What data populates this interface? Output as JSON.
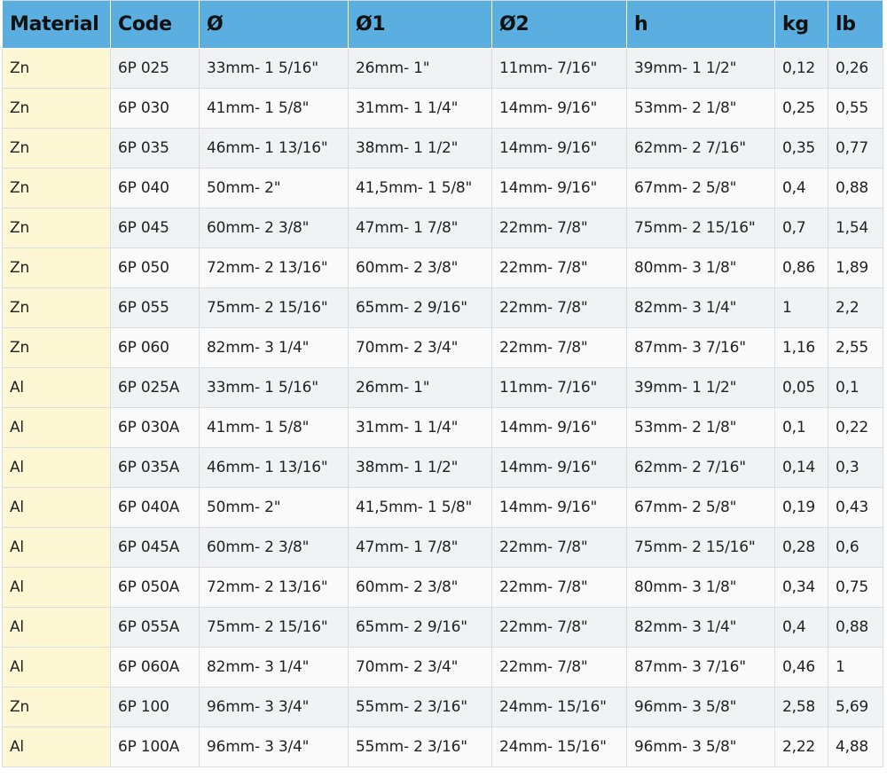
{
  "table": {
    "headers": [
      "Material",
      "Code",
      "Ø",
      "Ø1",
      "Ø2",
      "h",
      "kg",
      "lb"
    ],
    "rows": [
      [
        "Zn",
        "6P 025",
        "33mm- 1 5/16\"",
        "26mm- 1\"",
        "11mm- 7/16\"",
        "39mm- 1 1/2\"",
        "0,12",
        "0,26"
      ],
      [
        "Zn",
        "6P 030",
        "41mm- 1 5/8\"",
        "31mm- 1 1/4\"",
        "14mm- 9/16\"",
        "53mm- 2 1/8\"",
        "0,25",
        "0,55"
      ],
      [
        "Zn",
        "6P 035",
        "46mm- 1 13/16\"",
        "38mm- 1 1/2\"",
        "14mm- 9/16\"",
        "62mm- 2 7/16\"",
        "0,35",
        "0,77"
      ],
      [
        "Zn",
        "6P 040",
        "50mm- 2\"",
        "41,5mm- 1 5/8\"",
        "14mm- 9/16\"",
        "67mm- 2 5/8\"",
        "0,4",
        "0,88"
      ],
      [
        "Zn",
        "6P 045",
        "60mm- 2 3/8\"",
        "47mm- 1 7/8\"",
        "22mm- 7/8\"",
        "75mm- 2 15/16\"",
        "0,7",
        "1,54"
      ],
      [
        "Zn",
        "6P 050",
        "72mm- 2 13/16\"",
        "60mm- 2 3/8\"",
        "22mm- 7/8\"",
        "80mm- 3 1/8\"",
        "0,86",
        "1,89"
      ],
      [
        "Zn",
        "6P 055",
        "75mm- 2 15/16\"",
        "65mm- 2 9/16\"",
        "22mm- 7/8\"",
        "82mm- 3 1/4\"",
        "1",
        "2,2"
      ],
      [
        "Zn",
        "6P 060",
        "82mm- 3 1/4\"",
        "70mm- 2 3/4\"",
        "22mm- 7/8\"",
        "87mm- 3 7/16\"",
        "1,16",
        "2,55"
      ],
      [
        "Al",
        "6P 025A",
        "33mm- 1 5/16\"",
        "26mm- 1\"",
        "11mm- 7/16\"",
        "39mm- 1 1/2\"",
        "0,05",
        "0,1"
      ],
      [
        "Al",
        "6P 030A",
        "41mm- 1 5/8\"",
        "31mm- 1 1/4\"",
        "14mm- 9/16\"",
        "53mm- 2 1/8\"",
        "0,1",
        "0,22"
      ],
      [
        "Al",
        "6P 035A",
        "46mm- 1 13/16\"",
        "38mm- 1 1/2\"",
        "14mm- 9/16\"",
        "62mm- 2 7/16\"",
        "0,14",
        "0,3"
      ],
      [
        "Al",
        "6P 040A",
        "50mm- 2\"",
        "41,5mm- 1 5/8\"",
        "14mm- 9/16\"",
        "67mm- 2 5/8\"",
        "0,19",
        "0,43"
      ],
      [
        "Al",
        "6P 045A",
        "60mm- 2 3/8\"",
        "47mm- 1 7/8\"",
        "22mm- 7/8\"",
        "75mm- 2 15/16\"",
        "0,28",
        "0,6"
      ],
      [
        "Al",
        "6P 050A",
        "72mm- 2 13/16\"",
        "60mm- 2 3/8\"",
        "22mm- 7/8\"",
        "80mm- 3 1/8\"",
        "0,34",
        "0,75"
      ],
      [
        "Al",
        "6P 055A",
        "75mm- 2 15/16\"",
        "65mm- 2 9/16\"",
        "22mm- 7/8\"",
        "82mm- 3 1/4\"",
        "0,4",
        "0,88"
      ],
      [
        "Al",
        "6P 060A",
        "82mm- 3 1/4\"",
        "70mm- 2 3/4\"",
        "22mm- 7/8\"",
        "87mm- 3 7/16\"",
        "0,46",
        "1"
      ],
      [
        "Zn",
        "6P 100",
        "96mm- 3 3/4\"",
        "55mm- 2 3/16\"",
        "24mm- 15/16\"",
        "96mm- 3 5/8\"",
        "2,58",
        "5,69"
      ],
      [
        "Al",
        "6P 100A",
        "96mm- 3 3/4\"",
        "55mm- 2 3/16\"",
        "24mm- 15/16\"",
        "96mm- 3 5/8\"",
        "2,22",
        "4,88"
      ]
    ]
  },
  "colors": {
    "header_bg": "#5aaee0",
    "material_cell_bg": "#fdf7d3",
    "row_odd_bg": "#f1f2f3",
    "row_even_bg": "#fafafa",
    "grid_line": "#d8dde2"
  }
}
